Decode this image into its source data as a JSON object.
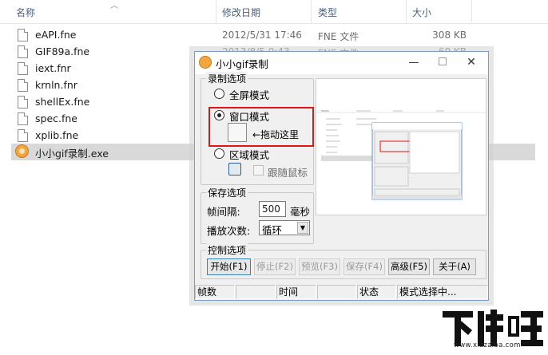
{
  "explorer": {
    "columns": {
      "name": "名称",
      "date": "修改日期",
      "type": "类型",
      "size": "大小"
    },
    "files": [
      {
        "name": "eAPI.fne",
        "date": "2012/5/31 17:46",
        "type": "FNE 文件",
        "size": "308 KB"
      },
      {
        "name": "GIF89a.fne",
        "date": "2013/8/5 0:43",
        "type": "FNE 文件",
        "size": "60 KB"
      },
      {
        "name": "iext.fnr",
        "date": "",
        "type": "",
        "size": ""
      },
      {
        "name": "krnln.fnr",
        "date": "",
        "type": "",
        "size": ""
      },
      {
        "name": "shellEx.fne",
        "date": "",
        "type": "",
        "size": ""
      },
      {
        "name": "spec.fne",
        "date": "",
        "type": "",
        "size": ""
      },
      {
        "name": "xplib.fne",
        "date": "",
        "type": "",
        "size": ""
      },
      {
        "name": "小小gif录制.exe",
        "date": "",
        "type": "",
        "size": ""
      }
    ]
  },
  "window": {
    "title": "小小gif录制",
    "minimize": "—",
    "close": "✕",
    "record_options": {
      "title": "录制选项",
      "fullscreen_label": "全屏模式",
      "window_label": "窗口模式",
      "drag_hint": "←拖动这里",
      "region_label": "区域模式",
      "follow_mouse_label": "跟随鼠标"
    },
    "save_options": {
      "title": "保存选项",
      "interval_label": "帧间隔:",
      "interval_value": "500",
      "interval_unit": "毫秒",
      "loop_label": "播放次数:",
      "loop_value": "循环"
    },
    "control_options": {
      "title": "控制选项",
      "start": "开始(F1)",
      "stop": "停止(F2)",
      "preview": "预览(F3)",
      "save": "保存(F4)",
      "advanced": "高级(F5)",
      "about": "关于(A)"
    },
    "status": {
      "frames_label": "帧数",
      "frames_value": "",
      "time_label": "时间",
      "time_value": "",
      "state_label": "状态",
      "state_value": "模式选择中..."
    }
  },
  "watermark": {
    "logo": "下载吧",
    "url": "www.xiazaiba.com"
  },
  "colors": {
    "highlight_red": "#e01616",
    "accent_blue": "#3c7fb1",
    "logo_dark": "#111111"
  }
}
